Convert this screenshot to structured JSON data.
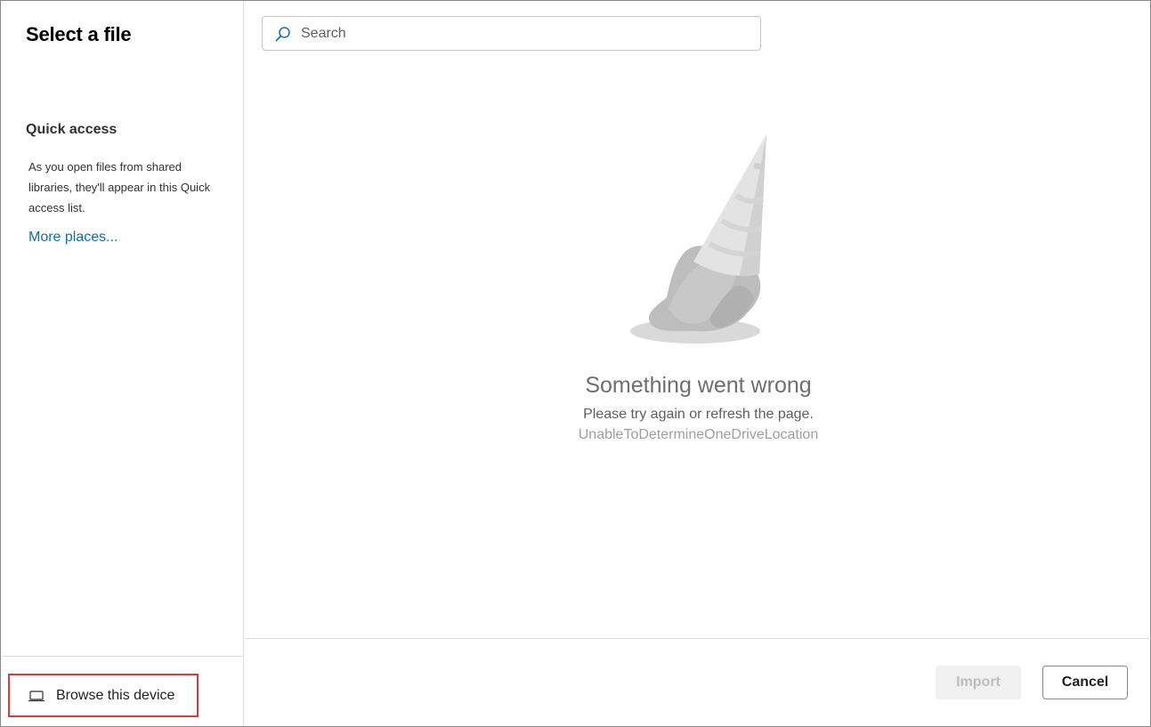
{
  "dialog": {
    "title": "Select a file"
  },
  "left_pane": {
    "quick_access": {
      "heading": "Quick access",
      "description": "As you open files from shared libraries, they'll appear in this Quick access list.",
      "more_places_link": "More places..."
    },
    "browse_device": {
      "label": "Browse this device",
      "icon": "laptop-icon",
      "highlight_color": "#e0383c"
    }
  },
  "search": {
    "placeholder": "Search",
    "value": "",
    "icon": "search-icon"
  },
  "error": {
    "illustration": "dropped-ice-cream-cone",
    "title": "Something went wrong",
    "message": "Please try again or refresh the page.",
    "code": "UnableToDetermineOneDriveLocation"
  },
  "footer": {
    "import_label": "Import",
    "import_disabled": true,
    "cancel_label": "Cancel"
  },
  "colors": {
    "link": "#0f6cbd",
    "border": "#e1dfdd"
  }
}
